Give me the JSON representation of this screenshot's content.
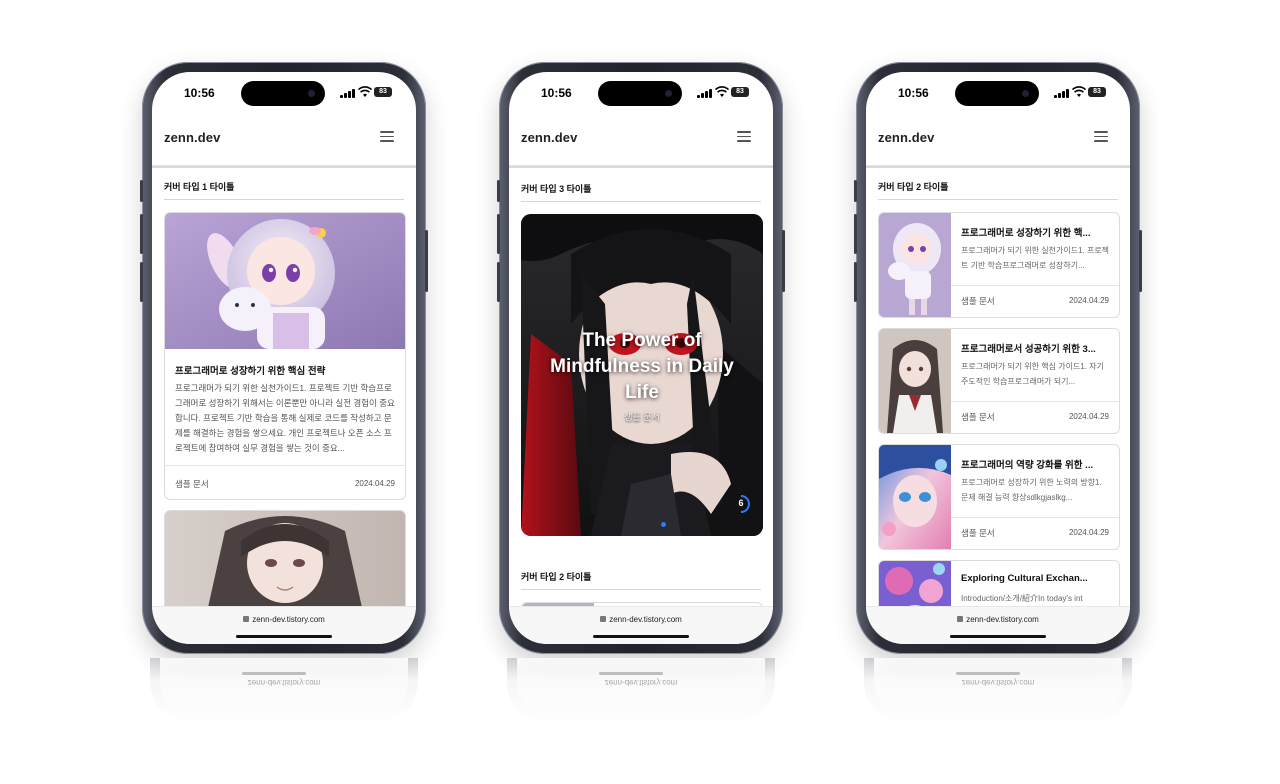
{
  "phones": [
    {
      "status": {
        "time": "10:56",
        "battery": "83"
      },
      "header": {
        "logo": "zenn.dev"
      },
      "section1": {
        "title": "커버 타입 1 타이틀"
      },
      "card": {
        "title": "프로그래머로 성장하기 위한 핵심 전략",
        "description": "프로그래머가 되기 위한 실천가이드1. 프로젝트 기반 학습프로그래머로 성장하기 위해서는 이론뿐만 아니라 실전 경험이 중요합니다. 프로젝트 기반 학습을 통해 실제로 코드를 작성하고 문제를 해결하는 경험을 쌓으세요. 개인 프로젝트나 오픈 소스 프로젝트에 참여하여 실무 경험을 쌓는 것이 중요...",
        "category": "샘플 문서",
        "date": "2024.04.29"
      },
      "urlbar": {
        "url": "zenn-dev.tistory.com"
      }
    },
    {
      "status": {
        "time": "10:56",
        "battery": "83"
      },
      "header": {
        "logo": "zenn.dev"
      },
      "section1": {
        "title": "커버 타입 3 타이틀"
      },
      "slide": {
        "title": "The Power of Mindfulness in Daily Life",
        "category": "샘플 문서",
        "counter": "6"
      },
      "section2": {
        "title": "커버 타입 2 타이틀"
      },
      "urlbar": {
        "url": "zenn-dev.tistory.com"
      }
    },
    {
      "status": {
        "time": "10:56",
        "battery": "83"
      },
      "header": {
        "logo": "zenn.dev"
      },
      "section1": {
        "title": "커버 타입 2 타이틀"
      },
      "cards": [
        {
          "title": "프로그래머로 성장하기 위한 핵...",
          "description": "프로그래머가 되기 위한 실천가이드1. 프로젝트 기반 학습프로그래머로 성장하기...",
          "category": "샘플 문서",
          "date": "2024.04.29"
        },
        {
          "title": "프로그래머로서 성공하기 위한 3...",
          "description": "프로그래머가 되기 위한 핵심 가이드1. 자기 주도적인 학습프로그래머가 되기...",
          "category": "샘플 문서",
          "date": "2024.04.29"
        },
        {
          "title": "프로그래머의 역량 강화를 위한 ...",
          "description": "프로그래머로 성장하기 위한 노력의 방향1. 문제 해결 능력 향상sdlkgjaslkg...",
          "category": "샘플 문서",
          "date": "2024.04.29"
        },
        {
          "title": "Exploring Cultural Exchan...",
          "description": "Introduction/소개/紹介In today's int",
          "category": "",
          "date": ""
        }
      ],
      "urlbar": {
        "url": "zenn-dev.tistory.com"
      }
    }
  ],
  "colors": {
    "accent": "#2f7df6",
    "frame": "#23262e"
  }
}
